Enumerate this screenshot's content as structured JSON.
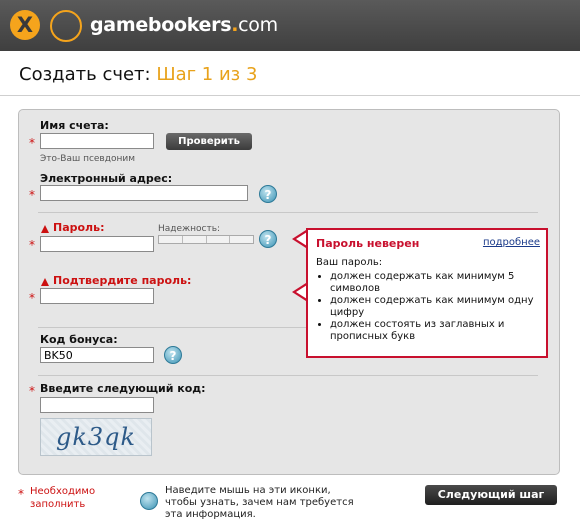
{
  "header": {
    "brand_name": "gamebookers",
    "brand_dot": ".",
    "brand_tld": "com"
  },
  "page": {
    "title_prefix": "Создать счет: ",
    "step_label": "Шаг 1 из 3"
  },
  "form": {
    "account_name_label": "Имя счета:",
    "account_name_value": "",
    "account_name_hint": "Это-Ваш псевдоним",
    "check_button": "Проверить",
    "email_label": "Электронный адрес:",
    "email_value": "",
    "password_label": "Пароль:",
    "password_value": "",
    "strength_label": "Надежность:",
    "confirm_label": "Подтвердите пароль:",
    "confirm_value": "",
    "bonus_label": "Код бонуса:",
    "bonus_value": "BK50",
    "captcha_label": "Введите следующий код:",
    "captcha_value": "",
    "captcha_text": "gk3qk",
    "required_mark": "*",
    "help_glyph": "?"
  },
  "error_popup": {
    "title": "Пароль неверен",
    "link": "подробнее",
    "intro": "Ваш пароль:",
    "rules": [
      "должен содержать как минимум 5 символов",
      "должен содержать как минимум одну цифру",
      "должен состоять из заглавных и прописных букв"
    ]
  },
  "footer": {
    "required_mark": "*",
    "required_line1": "Необходимо",
    "required_line2": "заполнить",
    "help_line1": "Наведите мышь на эти иконки,",
    "help_line2": "чтобы узнать, зачем нам требуется",
    "help_line3": "эта информация.",
    "next_button": "Следующий шаг"
  },
  "colors": {
    "accent": "#f5a41c",
    "error": "#c8102e",
    "header_bg": "#4a4a4a",
    "panel_bg": "#e6e6e6"
  }
}
